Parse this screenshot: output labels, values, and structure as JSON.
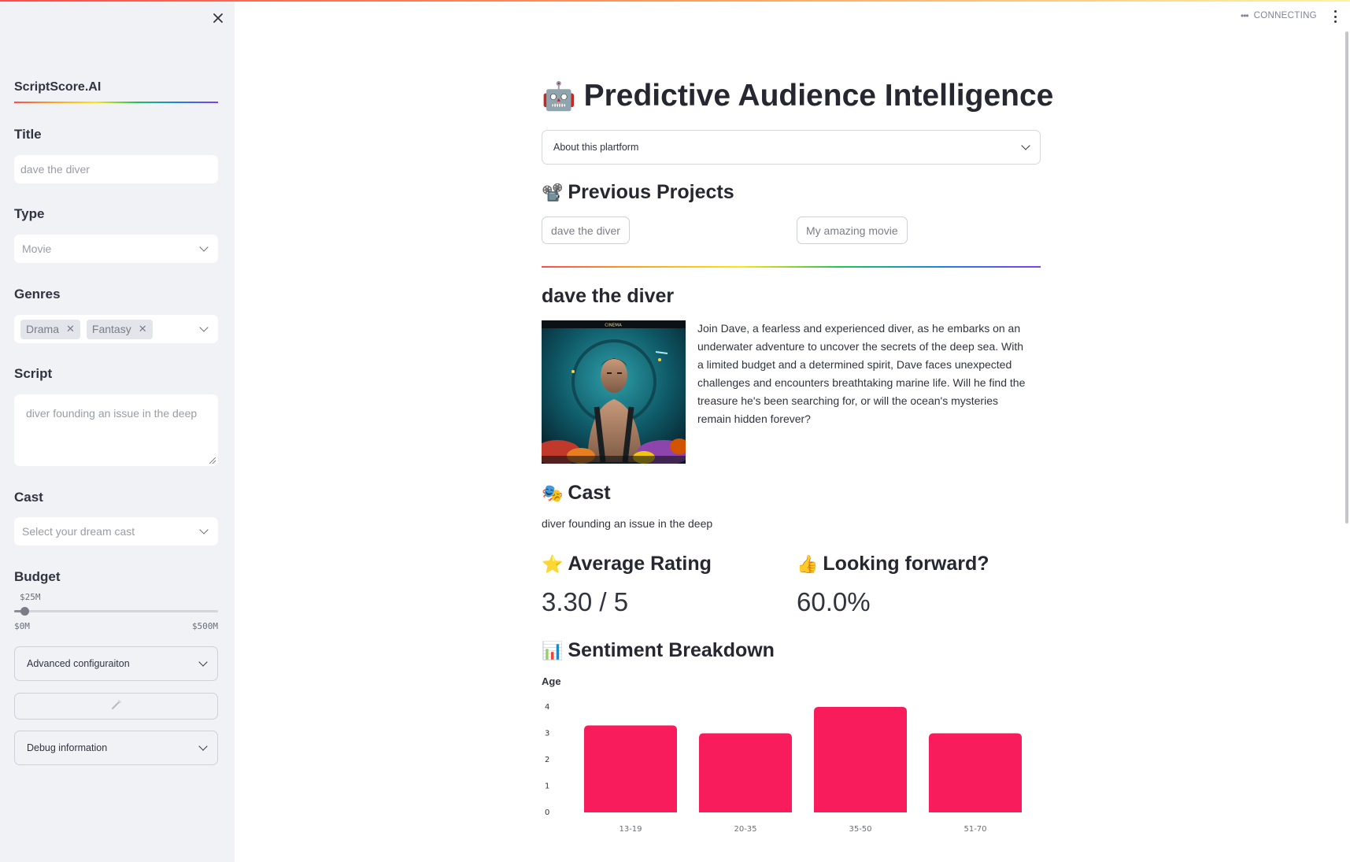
{
  "sidebar": {
    "brand": "ScriptScore.AI",
    "title_label": "Title",
    "title_value": "dave the diver",
    "type_label": "Type",
    "type_value": "Movie",
    "genres_label": "Genres",
    "genres": [
      "Drama",
      "Fantasy"
    ],
    "script_label": "Script",
    "script_value": "diver founding an issue in the deep",
    "cast_label": "Cast",
    "cast_placeholder": "Select your dream cast",
    "budget_label": "Budget",
    "budget_value": "$25M",
    "budget_min": "$0M",
    "budget_max": "$500M",
    "budget_fraction": 0.05,
    "advanced_label": "Advanced configuraiton",
    "debug_label": "Debug information"
  },
  "status": {
    "text": "CONNECTING"
  },
  "main": {
    "title_emoji": "🤖",
    "title": "Predictive Audience Intelligence",
    "about_label": "About this plartform",
    "previous_emoji": "📽️",
    "previous_heading": "Previous Projects",
    "projects": [
      "dave the diver",
      "My amazing movie"
    ],
    "project_title": "dave the diver",
    "poster_caption": "CINEMA",
    "synopsis": "Join Dave, a fearless and experienced diver, as he embarks on an underwater adventure to uncover the secrets of the deep sea. With a limited budget and a determined spirit, Dave faces unexpected challenges and encounters breathtaking marine life. Will he find the treasure he's been searching for, or will the ocean's mysteries remain hidden forever?",
    "cast_emoji": "🎭",
    "cast_heading": "Cast",
    "cast_text": "diver founding an issue in the deep",
    "rating_emoji": "⭐",
    "rating_heading": "Average Rating",
    "rating_value": "3.30 / 5",
    "forward_emoji": "👍",
    "forward_heading": "Looking forward?",
    "forward_value": "60.0%",
    "sentiment_emoji": "📊",
    "sentiment_heading": "Sentiment Breakdown"
  },
  "chart_data": {
    "type": "bar",
    "title": "",
    "xlabel": "",
    "ylabel": "Age",
    "categories": [
      "13-19",
      "20-35",
      "35-50",
      "51-70"
    ],
    "values": [
      3.3,
      3.0,
      4.0,
      3.0
    ],
    "yticks": [
      0,
      1,
      2,
      3,
      4
    ],
    "ylim": [
      0,
      4
    ],
    "color": "#f81c5c",
    "grid": false
  }
}
